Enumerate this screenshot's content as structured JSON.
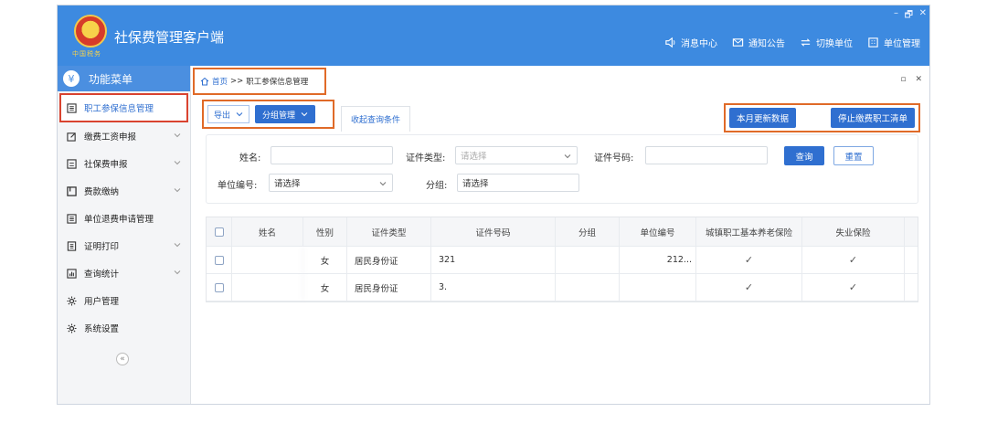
{
  "app": {
    "title": "社保费管理客户端",
    "logo_text": "中国税务",
    "window_controls": [
      "–",
      "🗗",
      "✕"
    ]
  },
  "top_nav": [
    {
      "icon": "speaker-icon",
      "label": "消息中心"
    },
    {
      "icon": "mail-icon",
      "label": "通知公告"
    },
    {
      "icon": "switch-icon",
      "label": "切换单位"
    },
    {
      "icon": "building-icon",
      "label": "单位管理"
    }
  ],
  "sidebar": {
    "header": "功能菜单",
    "items": [
      {
        "label": "职工参保信息管理",
        "icon": "list-icon",
        "expandable": false,
        "active": true
      },
      {
        "label": "缴费工资申报",
        "icon": "edit-icon",
        "expandable": true
      },
      {
        "label": "社保费申报",
        "icon": "form-icon",
        "expandable": true
      },
      {
        "label": "费款缴纳",
        "icon": "bill-icon",
        "expandable": true
      },
      {
        "label": "单位退费申请管理",
        "icon": "list-icon",
        "expandable": false
      },
      {
        "label": "证明打印",
        "icon": "doc-icon",
        "expandable": true
      },
      {
        "label": "查询统计",
        "icon": "chart-icon",
        "expandable": true
      },
      {
        "label": "用户管理",
        "icon": "gear-icon",
        "expandable": false
      },
      {
        "label": "系统设置",
        "icon": "gear-icon",
        "expandable": false
      }
    ],
    "collapse_glyph": "«"
  },
  "breadcrumb": {
    "home": "首页",
    "separator": ">>",
    "current": "职工参保信息管理",
    "controls": [
      "▫",
      "✕"
    ]
  },
  "toolbar": {
    "export_label": "导出",
    "group_label": "分组管理",
    "collapse_tab": "收起查询条件",
    "update_label": "本月更新数据",
    "stop_label": "停止缴费职工清单"
  },
  "filters": {
    "name_label": "姓名:",
    "idtype_label": "证件类型:",
    "idtype_placeholder": "请选择",
    "idno_label": "证件号码:",
    "unit_label": "单位编号:",
    "unit_value": "请选择",
    "group_label": "分组:",
    "group_value": "请选择",
    "query": "查询",
    "reset": "重置"
  },
  "table": {
    "columns": [
      "姓名",
      "性别",
      "证件类型",
      "证件号码",
      "分组",
      "单位编号",
      "城镇职工基本养老保险",
      "失业保险"
    ],
    "rows": [
      {
        "name": "",
        "gender": "女",
        "idtype": "居民身份证",
        "idno": "321",
        "group": "",
        "unit": "212...",
        "pension": "✓",
        "unemployment": "✓"
      },
      {
        "name": "",
        "gender": "女",
        "idtype": "居民身份证",
        "idno": "3.",
        "group": "",
        "unit": "",
        "pension": "✓",
        "unemployment": "✓"
      }
    ]
  },
  "colors": {
    "titlebar": "#3d8ae0",
    "primary": "#2f6fd0",
    "highlight_red": "#d9432f",
    "highlight_orange": "#e06a28"
  }
}
